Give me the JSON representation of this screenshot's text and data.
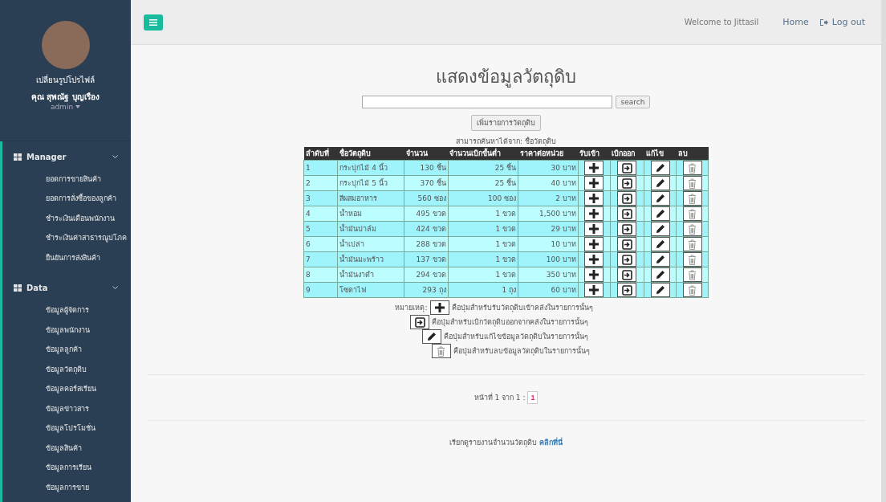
{
  "sidebar": {
    "profile": {
      "change_photo": "เปลี่ยนรูปโปรไฟล์",
      "name": "คุณ สุพณัฐ บุญเรือง",
      "role": "admin"
    },
    "sections": [
      {
        "title": "Manager",
        "items": [
          "ยอดการขายสินค้า",
          "ยอดการสั่งซื้อของลูกค้า",
          "ชำระเงินเดือนพนักงาน",
          "ชำระเงินค่าสาธารณูปโภค",
          "ยืนยันการส่งสินค้า"
        ]
      },
      {
        "title": "Data",
        "items": [
          "ข้อมูลผู้จัดการ",
          "ข้อมูลพนักงาน",
          "ข้อมูลลูกค้า",
          "ข้อมูลวัตถุดิบ",
          "ข้อมูลคอร์สเรียน",
          "ข้อมูลข่าวสาร",
          "ข้อมูลโปรโมชั่น",
          "ข้อมูลสินค้า",
          "ข้อมูลการเรียน",
          "ข้อมูลการขาย"
        ]
      }
    ]
  },
  "topbar": {
    "welcome": "Welcome to Jittasil",
    "links": [
      "Home",
      "Log out"
    ]
  },
  "page": {
    "title": "แสดงข้อมูลวัตถุดิบ",
    "search_button": "search",
    "add_button": "เพิ่มรายการวัตถุดิบ",
    "search_hint": "สามารถค้นหาได้จาก: ชื่อวัตถุดิบ"
  },
  "table": {
    "columns": [
      "ลำดับที่",
      "ชื่อวัตถุดิบ",
      "จำนวน",
      "จำนวนเบิกขั้นต่ำ",
      "ราคาต่อหน่วย",
      "รับเข้า",
      "เบิกออก",
      "แก้ไข",
      "ลบ"
    ],
    "rows": [
      [
        "1",
        "กระปุกไม้ 4 นิ้ว",
        "130 ชิ้น",
        "25 ชิ้น",
        "30 บาท"
      ],
      [
        "2",
        "กระปุกไม้ 5 นิ้ว",
        "370 ชิ้น",
        "25 ชิ้น",
        "40 บาท"
      ],
      [
        "3",
        "สีผสมอาหาร",
        "560 ซอง",
        "100 ซอง",
        "2 บาท"
      ],
      [
        "4",
        "น้ำหอม",
        "495 ขวด",
        "1 ขวด",
        "1,500 บาท"
      ],
      [
        "5",
        "น้ำมันปาล์ม",
        "424 ขวด",
        "1 ขวด",
        "29 บาท"
      ],
      [
        "6",
        "น้ำเปล่า",
        "288 ขวด",
        "1 ขวด",
        "10 บาท"
      ],
      [
        "7",
        "น้ำมันมะพร้าว",
        "137 ขวด",
        "1 ขวด",
        "100 บาท"
      ],
      [
        "8",
        "น้ำมันงาดำ",
        "294 ขวด",
        "1 ขวด",
        "350 บาท"
      ],
      [
        "9",
        "โซดาไฟ",
        "293 ถุง",
        "1 ถุง",
        "60 บาท"
      ]
    ]
  },
  "legend": {
    "label": "หมายเหตุ:",
    "notes": [
      {
        "kind": "add",
        "text": "คือปุ่มสำหรับรับวัตถุดิบเข้าคลังในรายการนั้นๆ"
      },
      {
        "kind": "withdraw",
        "text": "คือปุ่มสำหรับเบิกวัตถุดิบออกจากคลังในรายการนั้นๆ"
      },
      {
        "kind": "edit",
        "text": "คือปุ่มสำหรับแก้ไขข้อมูลวัตถุดิบในรายการนั้นๆ"
      },
      {
        "kind": "delete",
        "text": "คือปุ่มสำหรับลบข้อมูลวัตถุดิบในรายการนั้นๆ"
      }
    ]
  },
  "pagination": {
    "label": "หน้าที่ 1 จาก 1 :",
    "pages": [
      {
        "label": "1",
        "selected": true
      }
    ]
  },
  "report": {
    "text": "เรียกดูรายงานจำนวนวัตถุดิบ",
    "link": "คลิกที่นี่"
  }
}
